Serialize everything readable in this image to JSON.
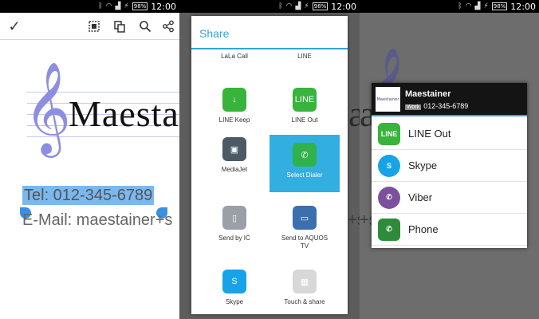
{
  "status_bar": {
    "time": "12:00",
    "battery": "98%"
  },
  "panel1": {
    "toolbar": {
      "confirm_icon": "check-icon",
      "select_all_icon": "select-all-icon",
      "copy_icon": "copy-icon",
      "search_icon": "search-icon",
      "share_icon": "share-icon"
    },
    "logo_text": "Maestainer",
    "tel_line": "Tel: 012-345-6789",
    "email_line": "E-Mail: maestainer+s"
  },
  "panel2": {
    "background_text": "a",
    "background_text2": "+s",
    "dialog_title": "Share",
    "apps": [
      {
        "label": "LaLa Call",
        "color": "#f07b2d",
        "icon": "lala-call-icon",
        "badge": ""
      },
      {
        "label": "LINE",
        "color": "#3bbc3c",
        "icon": "line-icon",
        "badge": "LINE"
      },
      {
        "label": "LINE Keep",
        "color": "#38b33b",
        "icon": "line-keep-icon",
        "badge": "↓"
      },
      {
        "label": "LINE Out",
        "color": "#38b33b",
        "icon": "line-out-icon",
        "badge": "LINE"
      },
      {
        "label": "MediaJet",
        "color": "#4c5a66",
        "icon": "mediajet-icon",
        "badge": "▣"
      },
      {
        "label": "Select Dialer",
        "color": "#2fb24b",
        "icon": "select-dialer-icon",
        "badge": "✆"
      },
      {
        "label": "Send by IC",
        "color": "#9aa0a6",
        "icon": "send-by-ic-icon",
        "badge": "▯"
      },
      {
        "label": "Send to AQUOS TV",
        "color": "#3b6fb0",
        "icon": "aquos-tv-icon",
        "badge": "▭"
      },
      {
        "label": "Skype",
        "color": "#16a3e8",
        "icon": "skype-icon",
        "badge": "S"
      },
      {
        "label": "Touch & share",
        "color": "#d8d8d8",
        "icon": "touch-share-icon",
        "badge": "▦"
      }
    ]
  },
  "panel3": {
    "background_text": "a",
    "background_text2": "+s",
    "contact_name": "Maestainer",
    "work_tag": "Work",
    "contact_phone": "012-345-6789",
    "thumb_text": "Maestainer",
    "options": [
      {
        "label": "LINE Out",
        "color": "#38b33b",
        "icon": "line-out-icon",
        "badge": "LINE",
        "round": false
      },
      {
        "label": "Skype",
        "color": "#16a3e8",
        "icon": "skype-icon",
        "badge": "S",
        "round": true
      },
      {
        "label": "Viber",
        "color": "#7b519d",
        "icon": "viber-icon",
        "badge": "✆",
        "round": true
      },
      {
        "label": "Phone",
        "color": "#2e8b3a",
        "icon": "phone-icon",
        "badge": "✆",
        "round": false
      }
    ]
  }
}
